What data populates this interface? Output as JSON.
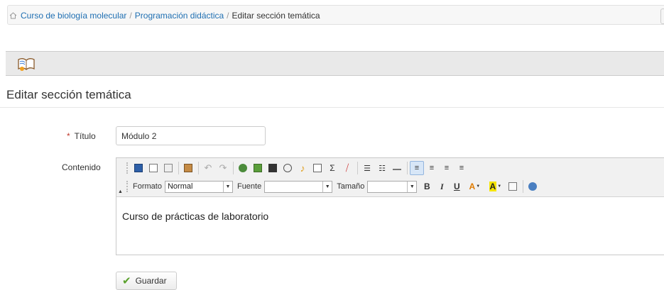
{
  "breadcrumb": {
    "items": [
      "Curso de biología molecular",
      "Programación didáctica"
    ],
    "separator": "/",
    "current": "Editar sección temática"
  },
  "page": {
    "title": "Editar sección temática"
  },
  "form": {
    "titulo_label": "Título",
    "required_mark": "*",
    "titulo_value": "Módulo 2",
    "contenido_label": "Contenido",
    "content_text": "Curso de prácticas de laboratorio",
    "save_label": "Guardar"
  },
  "editor": {
    "formato_label": "Formato",
    "formato_value": "Normal",
    "fuente_label": "Fuente",
    "fuente_value": "",
    "tamano_label": "Tamaño",
    "tamano_value": "",
    "bold": "B",
    "italic": "I",
    "underline": "U",
    "text_color": "A",
    "bg_color": "A",
    "sigma": "Σ"
  },
  "colors": {
    "link": "#1f6fb2",
    "required": "#c0392b",
    "check": "#5aa12c"
  }
}
